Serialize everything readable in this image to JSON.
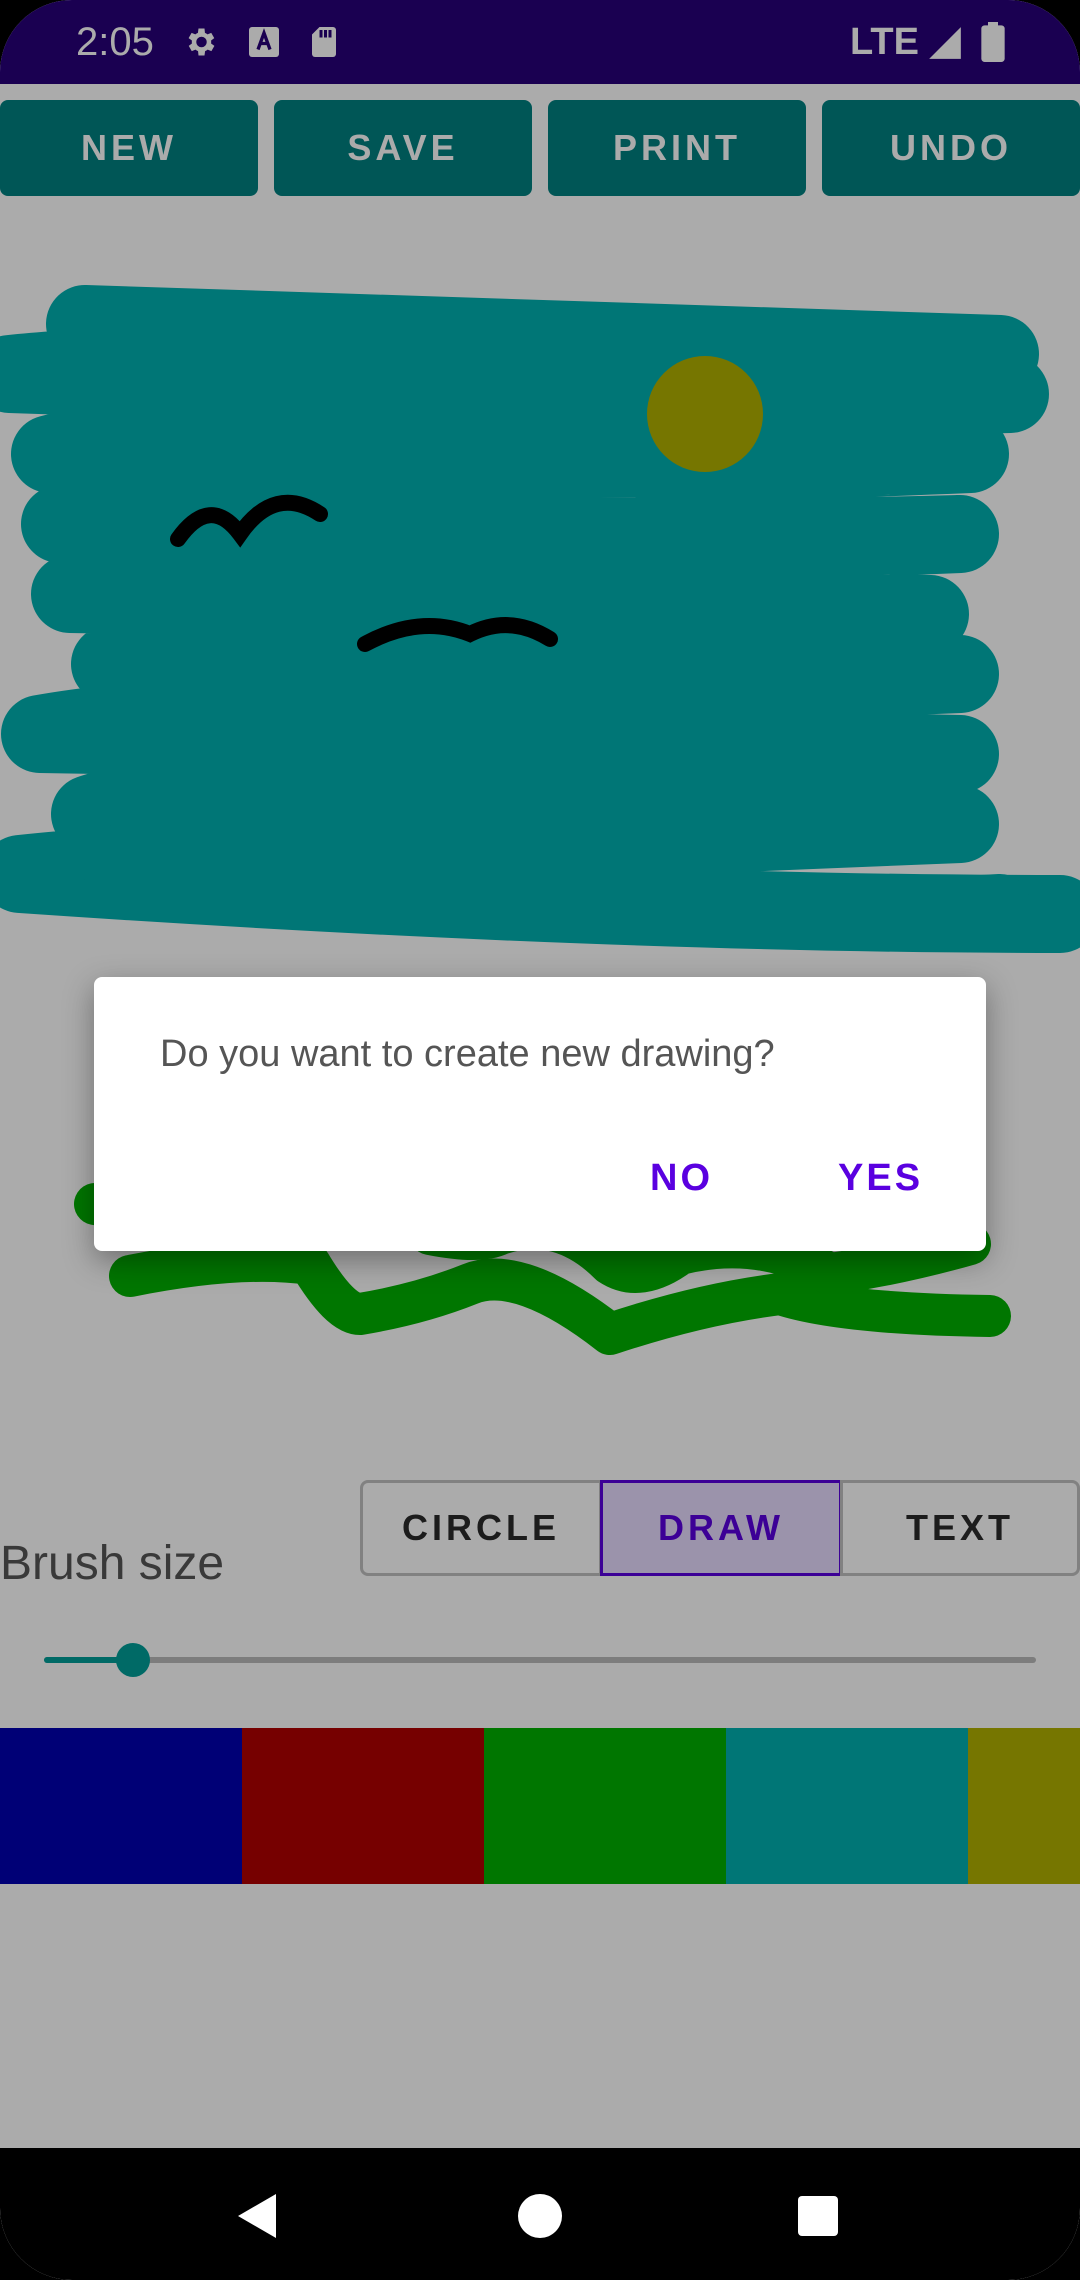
{
  "status_bar": {
    "time": "2:05",
    "network": "LTE",
    "icons": [
      "settings-icon",
      "font-a-icon",
      "sd-card-icon",
      "signal-icon",
      "battery-icon"
    ]
  },
  "toolbar": {
    "buttons": [
      "NEW",
      "SAVE",
      "PRINT",
      "UNDO"
    ]
  },
  "canvas": {
    "colors": {
      "sky": "#00b0b0",
      "sun": "#b0b000",
      "birds": "#000000",
      "grass": "#00b000"
    }
  },
  "mode_selector": {
    "options": [
      "CIRCLE",
      "DRAW",
      "TEXT"
    ],
    "selected": "DRAW"
  },
  "brush": {
    "label": "Brush size",
    "value_fraction": 0.09
  },
  "palette": {
    "colors": [
      "#0000b0",
      "#b00000",
      "#00b000",
      "#00b0b0",
      "#b0b000"
    ]
  },
  "dialog": {
    "message": "Do you want to create new drawing?",
    "no_label": "NO",
    "yes_label": "YES"
  },
  "nav_bar": {
    "icons": [
      "back-icon",
      "home-icon",
      "recents-icon"
    ]
  }
}
